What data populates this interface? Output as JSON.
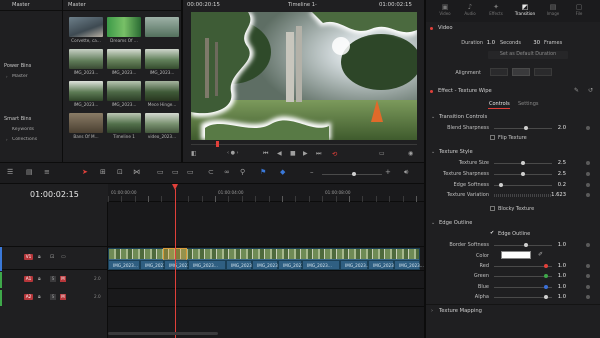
{
  "media_pool": {
    "header": "Master",
    "bins_header": "Master",
    "power_bins": {
      "title": "Power Bins",
      "items": [
        "Master"
      ]
    },
    "smart_bins": {
      "title": "Smart Bins",
      "items": [
        "Keywords",
        "Collections"
      ]
    },
    "clips": [
      {
        "label": "Corvette, ca..."
      },
      {
        "label": "Dreams Of ..."
      },
      {
        "label": ""
      },
      {
        "label": ""
      },
      {
        "label": "IMG_2023..."
      },
      {
        "label": "IMG_2023..."
      },
      {
        "label": "IMG_2023..."
      },
      {
        "label": "IMG_2023..."
      },
      {
        "label": "IMG_2023..."
      },
      {
        "label": "IMG_2023..."
      },
      {
        "label": "IMG_2023..."
      },
      {
        "label": "Mece Hinge..."
      },
      {
        "label": "Bans Of M..."
      },
      {
        "label": "Timeline 1"
      },
      {
        "label": "video_2023..."
      }
    ]
  },
  "viewer": {
    "source_timecode": "00:00:20:15",
    "timeline_name": "Timeline 1",
    "record_timecode": "01:00:02:15"
  },
  "inspector": {
    "tabs": [
      "Video",
      "Audio",
      "Effects",
      "Transition",
      "Image",
      "File"
    ],
    "active_tab": "Transition",
    "video_section": "Video",
    "duration_label": "Duration",
    "duration_value": "1.0",
    "duration_unit": "Seconds",
    "frames_value": "30",
    "frames_unit": "Frames",
    "set_default_button": "Set as Default Duration",
    "alignment_label": "Alignment",
    "effect_title": "Effect - Texture Wipe",
    "subtabs": [
      "Controls",
      "Settings"
    ],
    "transition_controls": {
      "title": "Transition Controls",
      "blend_sharpness_label": "Blend Sharpness",
      "blend_sharpness_value": "2.0",
      "blend_sharpness_level": 0.55,
      "flip_texture_label": "Flip Texture"
    },
    "texture_style": {
      "title": "Texture Style",
      "texture_size_label": "Texture Size",
      "texture_size_value": "2.5",
      "texture_size_level": 0.5,
      "texture_sharpness_label": "Texture Sharpness",
      "texture_sharpness_value": "2.5",
      "texture_sharpness_level": 0.5,
      "edge_softness_label": "Edge Softness",
      "edge_softness_value": "0.2",
      "edge_softness_level": 0.12,
      "texture_variation_label": "Texture Variation",
      "texture_variation_value": "1.623",
      "blocky_texture_label": "Blocky Texture"
    },
    "edge_outline": {
      "title": "Edge Outline",
      "edge_outline_label": "Edge Outline",
      "border_softness_label": "Border Softness",
      "border_softness_value": "1.0",
      "border_softness_level": 0.55,
      "color_label": "Color",
      "color_hex": "#ffffff",
      "red_label": "Red",
      "red_value": "1.0",
      "green_label": "Green",
      "green_value": "1.0",
      "blue_label": "Blue",
      "blue_value": "1.0",
      "alpha_label": "Alpha",
      "alpha_value": "1.0"
    },
    "texture_mapping_title": "Texture Mapping"
  },
  "timeline": {
    "timecode": "01:00:02:15",
    "ruler": [
      "01:00:00:00",
      "01:00:04:00",
      "01:00:08:00"
    ],
    "tracks": {
      "v1": "V1",
      "a1": "A1",
      "a2": "A2",
      "a1_level": "2.0",
      "a2_level": "2.0"
    },
    "audio_clips": [
      "IMG_2023...",
      "IMG_2023...",
      "IMG_2023...",
      "IMG_2023...",
      "IMG_2023...",
      "IMG_2023...",
      "IMG_2023...",
      "IMG_2023...",
      "IMG_2023...",
      "IMG_2023...",
      "IMG_2023..."
    ]
  },
  "colors": {
    "accent_red": "#e0403a",
    "clip_blue": "#3d6a86",
    "audio_blue": "#2f5f82",
    "track_red": "#b6363a"
  }
}
